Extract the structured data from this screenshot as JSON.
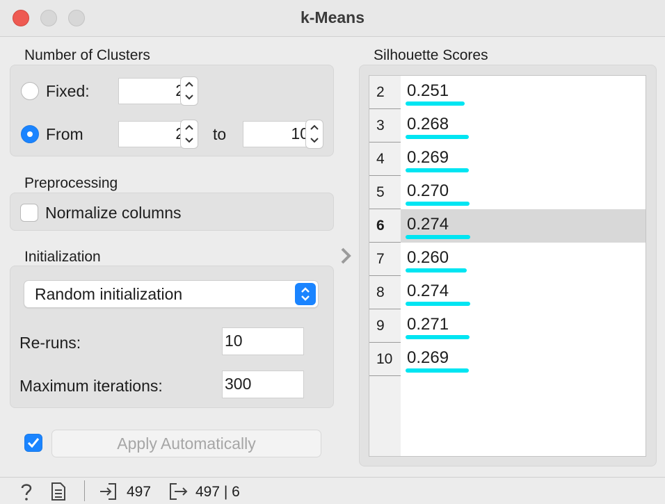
{
  "window": {
    "title": "k-Means"
  },
  "clusters": {
    "section_label": "Number of Clusters",
    "fixed_label": "Fixed:",
    "fixed_value": "2",
    "from_label": "From",
    "from_value": "2",
    "to_label": "to",
    "to_value": "10",
    "selected_mode": "From"
  },
  "preprocessing": {
    "section_label": "Preprocessing",
    "normalize_label": "Normalize columns",
    "normalize_checked": false
  },
  "initialization": {
    "section_label": "Initialization",
    "method": "Random initialization",
    "reruns_label": "Re-runs:",
    "reruns_value": "10",
    "maxiter_label": "Maximum iterations:",
    "maxiter_value": "300"
  },
  "apply": {
    "label": "Apply Automatically",
    "auto_checked": true
  },
  "silhouette": {
    "section_label": "Silhouette Scores",
    "selected_k": "6",
    "rows": [
      {
        "k": "2",
        "score": "0.251"
      },
      {
        "k": "3",
        "score": "0.268"
      },
      {
        "k": "4",
        "score": "0.269"
      },
      {
        "k": "5",
        "score": "0.270"
      },
      {
        "k": "6",
        "score": "0.274"
      },
      {
        "k": "7",
        "score": "0.260"
      },
      {
        "k": "8",
        "score": "0.274"
      },
      {
        "k": "9",
        "score": "0.271"
      },
      {
        "k": "10",
        "score": "0.269"
      }
    ]
  },
  "status": {
    "input_count": "497",
    "output_count": "497 | 6"
  },
  "colors": {
    "accent": "#1a84ff",
    "score_bar": "#00e5f2",
    "selected_row": "#d8d8d8"
  },
  "icons": [
    "help-icon",
    "report-icon",
    "input-icon",
    "output-icon",
    "chevron-down-icon",
    "chevron-right-icon"
  ]
}
